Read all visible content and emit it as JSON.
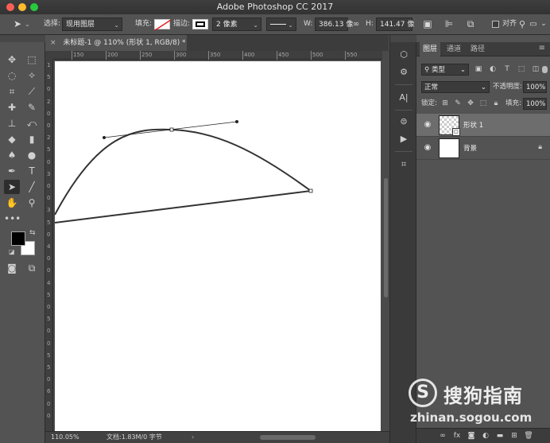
{
  "window": {
    "title": "Adobe Photoshop CC 2017"
  },
  "options_bar": {
    "select_label": "选择:",
    "select_value": "现用图层",
    "fill_label": "填充:",
    "stroke_label": "描边:",
    "stroke_width": "2 像素",
    "w_label": "W:",
    "w_value": "386.13 像",
    "h_label": "H:",
    "h_value": "141.47 像",
    "align_label": "对齐"
  },
  "document": {
    "tab_title": "未标题-1 @ 110% (形状 1, RGB/8) *",
    "ruler_labels": [
      "150",
      "200",
      "250",
      "300",
      "350",
      "400",
      "450",
      "500",
      "550"
    ],
    "vruler_labels": [
      "1",
      "5",
      "0",
      "2",
      "0",
      "0",
      "2",
      "5",
      "0",
      "3",
      "0",
      "0",
      "3",
      "5",
      "0",
      "4",
      "0",
      "0",
      "4",
      "5",
      "0",
      "5",
      "0",
      "0",
      "5",
      "5",
      "0",
      "6",
      "0",
      "0"
    ]
  },
  "status_bar": {
    "zoom": "110.05%",
    "doc_info": "文档:1.83M/0 字节",
    "arrow": "›"
  },
  "layers_panel": {
    "tabs": [
      "图层",
      "通道",
      "路径"
    ],
    "filter_kind": "类型",
    "blend_mode": "正常",
    "opacity_label": "不透明度:",
    "opacity_value": "100%",
    "lock_label": "锁定:",
    "fill_label": "填充:",
    "fill_value": "100%",
    "layers": [
      {
        "name": "形状 1",
        "selected": true
      },
      {
        "name": "背景",
        "selected": false
      }
    ]
  },
  "watermark": {
    "logo": "S",
    "text": "搜狗指南",
    "url": "zhinan.sogou.com"
  },
  "colors": {
    "ui_bg": "#535353",
    "canvas": "#ffffff",
    "selected_layer": "#6d6d6d"
  }
}
